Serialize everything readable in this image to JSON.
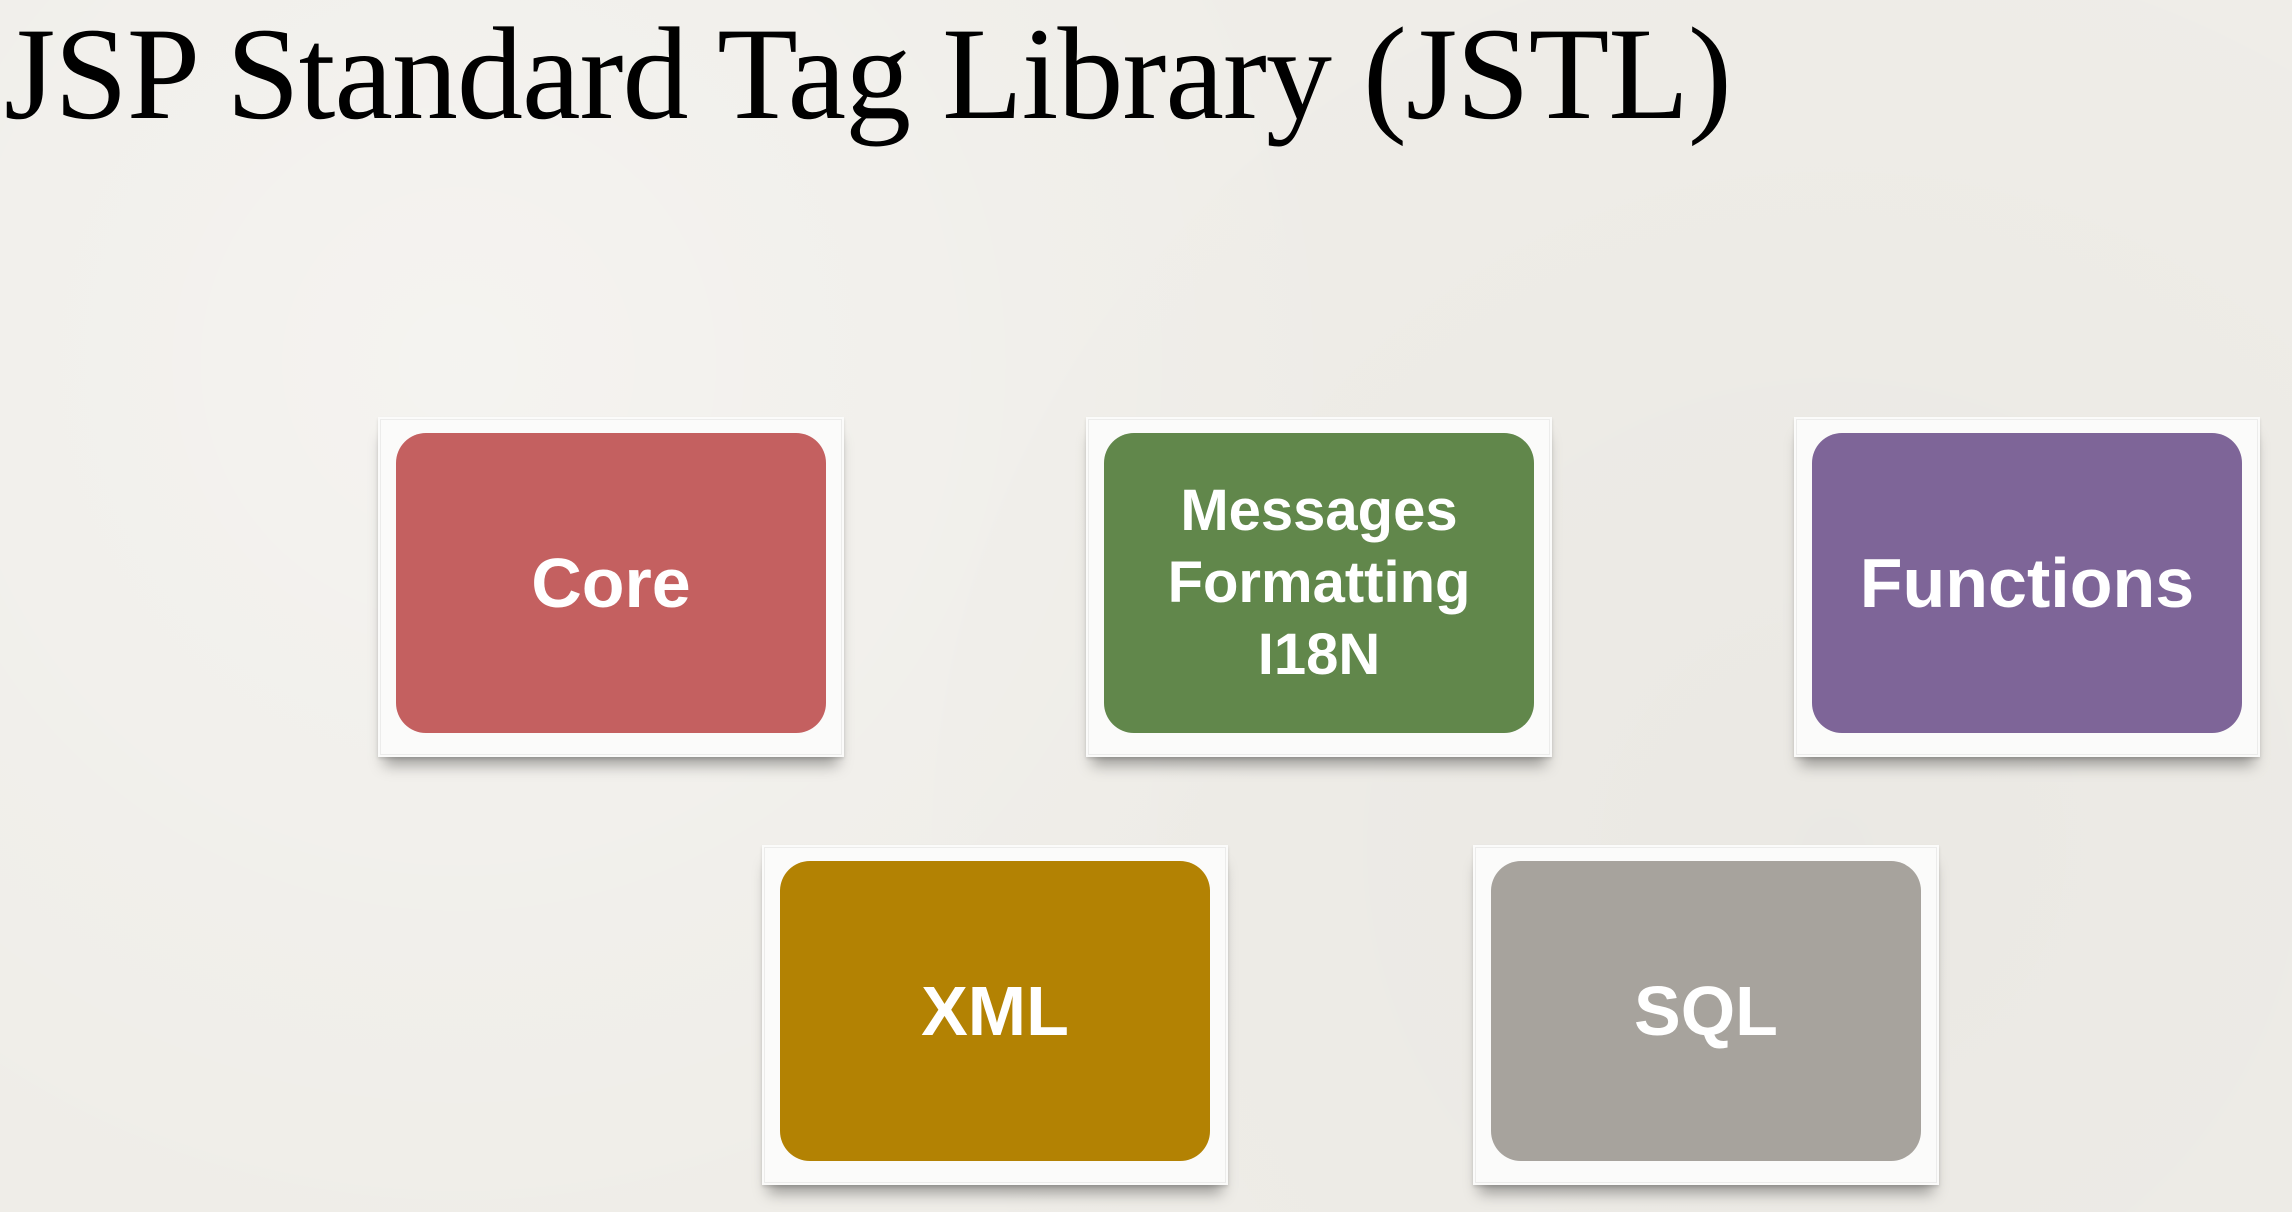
{
  "title": "JSP Standard Tag Library (JSTL)",
  "cards": {
    "core": {
      "lines": [
        "Core"
      ],
      "color": "#c46060"
    },
    "messages": {
      "lines": [
        "Messages",
        "Formatting",
        "I18N"
      ],
      "color": "#61874b"
    },
    "functions": {
      "lines": [
        "Functions"
      ],
      "color": "#7e6598"
    },
    "xml": {
      "lines": [
        "XML"
      ],
      "color": "#b38203"
    },
    "sql": {
      "lines": [
        "SQL"
      ],
      "color": "#a7a39d"
    }
  }
}
